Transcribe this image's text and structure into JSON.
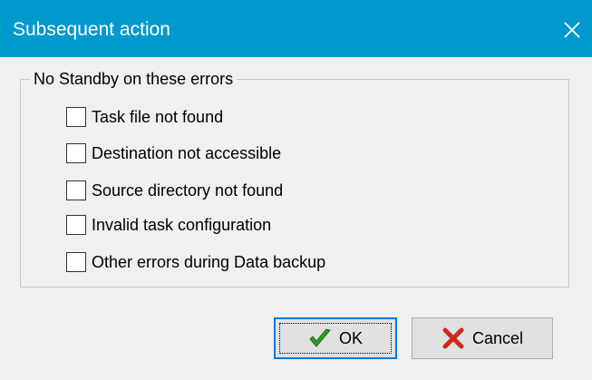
{
  "window": {
    "title": "Subsequent action",
    "close_icon": "close-icon",
    "accent_color": "#0099cc"
  },
  "group": {
    "legend": "No Standby on these errors",
    "options": [
      {
        "label": "Task file not found",
        "checked": false
      },
      {
        "label": "Destination not accessible",
        "checked": false
      },
      {
        "label": "Source directory not found",
        "checked": false
      },
      {
        "label": "Invalid task configuration",
        "checked": false
      },
      {
        "label": "Other errors during Data backup",
        "checked": false
      }
    ]
  },
  "buttons": {
    "ok_label": "OK",
    "ok_icon": "checkmark-icon",
    "cancel_label": "Cancel",
    "cancel_icon": "x-icon"
  }
}
